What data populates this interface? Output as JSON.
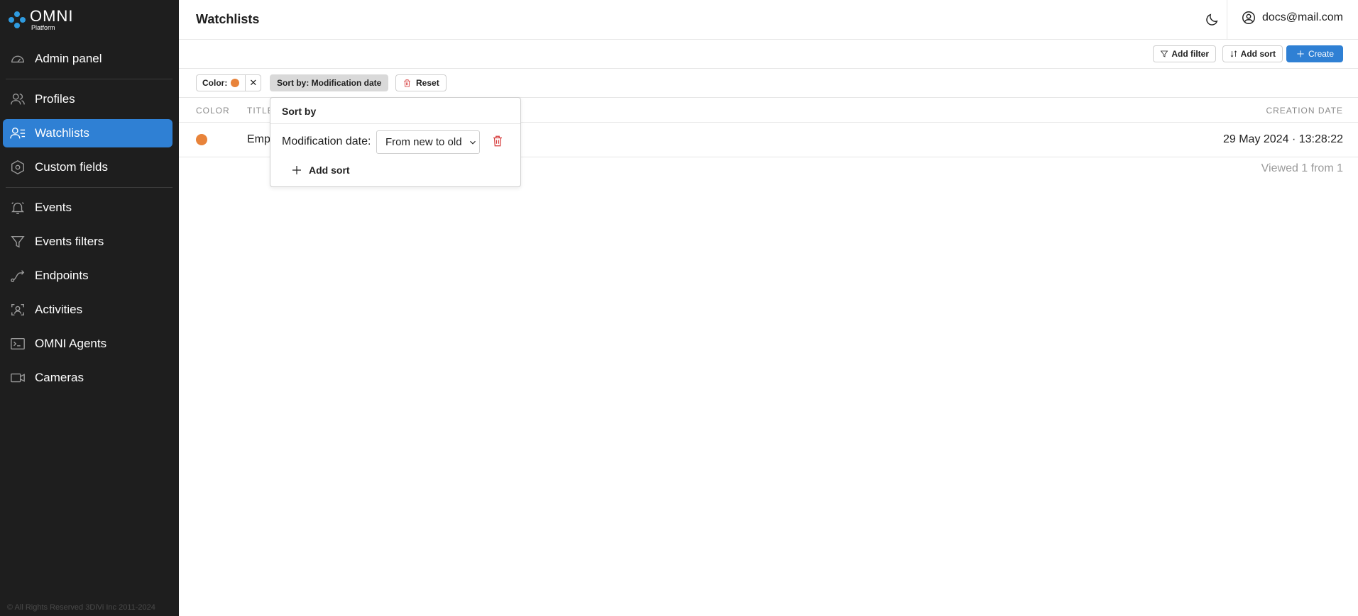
{
  "brand": {
    "name": "OMNI",
    "sub": "Platform",
    "accent": "#2f9be0"
  },
  "sidebar": {
    "items": [
      {
        "label": "Admin panel",
        "icon": "gauge-icon"
      },
      {
        "label": "Profiles",
        "icon": "users-icon"
      },
      {
        "label": "Watchlists",
        "icon": "user-list-icon",
        "active": true
      },
      {
        "label": "Custom fields",
        "icon": "hexagon-icon"
      },
      {
        "label": "Events",
        "icon": "bell-icon"
      },
      {
        "label": "Events filters",
        "icon": "filter-icon"
      },
      {
        "label": "Endpoints",
        "icon": "route-icon"
      },
      {
        "label": "Activities",
        "icon": "scan-user-icon"
      },
      {
        "label": "OMNI Agents",
        "icon": "terminal-icon"
      },
      {
        "label": "Cameras",
        "icon": "video-icon"
      }
    ],
    "copyright": "© All Rights Reserved 3DiVi Inc 2011-2024"
  },
  "header": {
    "title": "Watchlists",
    "user": "docs@mail.com"
  },
  "toolbar": {
    "add_filter": "Add filter",
    "add_sort": "Add sort",
    "create": "Create",
    "accent": "#2f80d4"
  },
  "chips": {
    "color_label": "Color:",
    "color_value": "#e8833a",
    "sort_label": "Sort by: Modification date",
    "reset_label": "Reset"
  },
  "table": {
    "columns": {
      "color": "COLOR",
      "title": "TITLE",
      "creation_date": "CREATION DATE"
    },
    "rows": [
      {
        "color": "#e8833a",
        "title": "Emp",
        "creation_date": "29 May 2024 · 13:28:22"
      }
    ],
    "footer": "Viewed 1 from 1"
  },
  "sort_popover": {
    "title": "Sort by",
    "field_label": "Modification date:",
    "order_value": "From new to old",
    "add_label": "Add sort"
  }
}
